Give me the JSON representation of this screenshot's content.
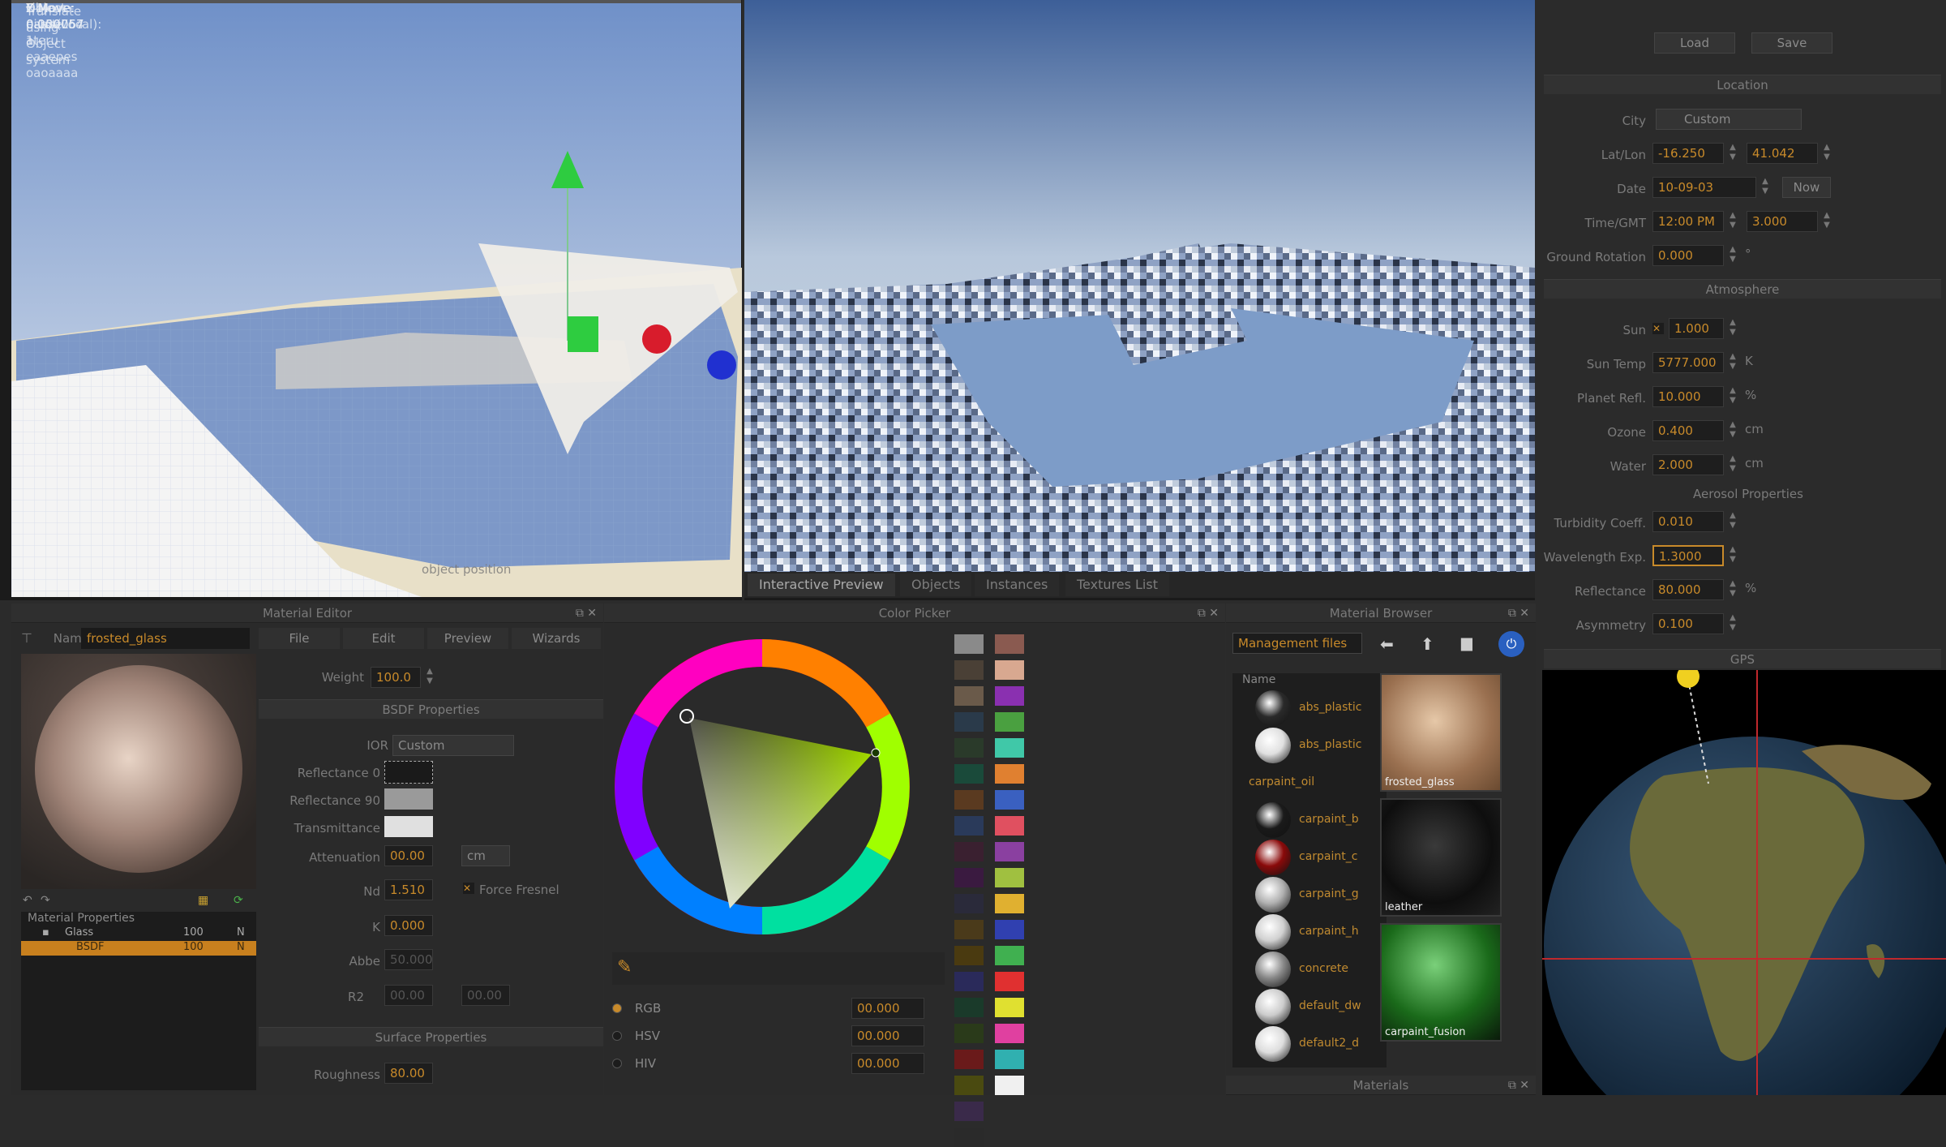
{
  "viewport_left": {
    "overlay_lines": [
      "Fil eaase ateru eaaepes oaoaaaa",
      "Translate using Object system",
      "Object pivot(Local): 1",
      "X Move: 0.000057",
      "Y Move: 0.150764",
      "Z Move: 0.000057"
    ],
    "bottom_label": "object position"
  },
  "viewport_right": {
    "tabs": [
      "Interactive Preview",
      "Objects",
      "Instances",
      "Textures List"
    ],
    "active_tab": 0
  },
  "material_editor": {
    "title": "Material Editor",
    "name_label": "Name",
    "name_value": "frosted_glass",
    "menus": [
      "File",
      "Edit",
      "Preview",
      "Wizards"
    ],
    "weight_label": "Weight",
    "weight_value": "100.0",
    "bsdf_title": "BSDF Properties",
    "ior_label": "IOR",
    "ior_value": "Custom",
    "reflectance0_label": "Reflectance 0",
    "reflectance90_label": "Reflectance 90",
    "transmittance_label": "Transmittance",
    "attenuation_label": "Attenuation",
    "attenuation_value": "00.00",
    "attenuation_unit": "cm",
    "nd_label": "Nd",
    "nd_value": "1.510",
    "fresnel_label": "Force Fresnel",
    "k_label": "K",
    "k_value": "0.000",
    "abbe_label": "Abbe",
    "abbe_value": "50.000",
    "r2_label": "R2",
    "r2_value_a": "00.00",
    "r2_value_b": "00.00",
    "surface_title": "Surface Properties",
    "roughness_label": "Roughness",
    "roughness_value": "80.00",
    "tree_title": "Material Properties",
    "tree_item1": "Glass",
    "tree_item1_val": "100",
    "tree_item1_val2": "N",
    "tree_item2": "BSDF",
    "tree_item2_val": "100",
    "tree_item2_val2": "N"
  },
  "color_picker": {
    "title": "Color Picker",
    "modes": [
      "RGB",
      "HSV",
      "HIV"
    ],
    "mode_values": [
      "00.000",
      "00.000",
      "00.000"
    ],
    "palette_left": [
      "#8a8a8a",
      "#4a4036",
      "#6a5a4a",
      "#2a3a4a",
      "#2a3a2a",
      "#1a4a3a",
      "#5a3a20",
      "#2a3a5a",
      "#3a2030",
      "#3a1a40",
      "#2a2a3a",
      "#4a3a1a",
      "#4a3a10",
      "#2a2a5a",
      "#1a3a2a",
      "#2a3a1a",
      "#6a1a1a",
      "#4a4a10",
      "#3a2a4a",
      "#2a2a2a"
    ],
    "palette_right": [
      "#8a5a50",
      "#d8a890",
      "#8a30b0",
      "#4aa040",
      "#40c8a8",
      "#e08030",
      "#3a60c0",
      "#e05060",
      "#8a40a0",
      "#a0c040",
      "#e0b030",
      "#3040b0",
      "#40b050",
      "#e03030",
      "#e0e030",
      "#e040a0",
      "#30b0b0",
      "#f0f0f0"
    ]
  },
  "material_browser": {
    "title": "Material Browser",
    "location": "Management files",
    "column_header": "Name",
    "items": [
      {
        "name": "abs_plastic",
        "color": "#2a2a2a"
      },
      {
        "name": "abs_plastic",
        "color": "#e0e0e0"
      },
      {
        "name": "carpaint_oil",
        "color": ""
      },
      {
        "name": "carpaint_b",
        "color": "#1a1a1a"
      },
      {
        "name": "carpaint_c",
        "color": "#8a0a0a"
      },
      {
        "name": "carpaint_g",
        "color": "#b0b0b0"
      },
      {
        "name": "carpaint_h",
        "color": "#d0d0d0"
      },
      {
        "name": "concrete",
        "color": "#888888"
      },
      {
        "name": "default_dw",
        "color": "#cccccc"
      },
      {
        "name": "default2_d",
        "color": "#dddddd"
      }
    ],
    "thumbs": [
      {
        "name": "frosted_glass"
      },
      {
        "name": "leather"
      },
      {
        "name": "carpaint_fusion"
      }
    ],
    "footer_title": "Materials"
  },
  "sky_panel": {
    "load_label": "Load",
    "save_label": "Save",
    "location_title": "Location",
    "city_label": "City",
    "city_value": "Custom",
    "latlon_label": "Lat/Lon",
    "lat_value": "-16.250",
    "lon_value": "41.042",
    "date_label": "Date",
    "date_value": "10-09-03",
    "now_label": "Now",
    "time_label": "Time/GMT",
    "time_value": "12:00 PM",
    "gmt_value": "3.000",
    "ground_label": "Ground Rotation",
    "ground_value": "0.000",
    "ground_unit": "°",
    "atmosphere_title": "Atmosphere",
    "sun_label": "Sun",
    "sun_value": "1.000",
    "suntemp_label": "Sun Temp",
    "suntemp_value": "5777.000",
    "suntemp_unit": "K",
    "planet_label": "Planet Refl.",
    "planet_value": "10.000",
    "planet_unit": "%",
    "ozone_label": "Ozone",
    "ozone_value": "0.400",
    "ozone_unit": "cm",
    "water_label": "Water",
    "water_value": "2.000",
    "water_unit": "cm",
    "aerosol_title": "Aerosol Properties",
    "turbidity_label": "Turbidity Coeff.",
    "turbidity_value": "0.010",
    "wavelength_label": "Wavelength Exp.",
    "wavelength_value": "1.3000",
    "reflectance_label": "Reflectance",
    "reflectance_value": "80.000",
    "reflectance_unit": "%",
    "asymmetry_label": "Asymmetry",
    "asymmetry_value": "0.100",
    "gps_title": "GPS"
  },
  "colors": {
    "accent_orange": "#c88a2a",
    "panel_bg": "#2b2b2b",
    "selection": "#c8801e"
  }
}
